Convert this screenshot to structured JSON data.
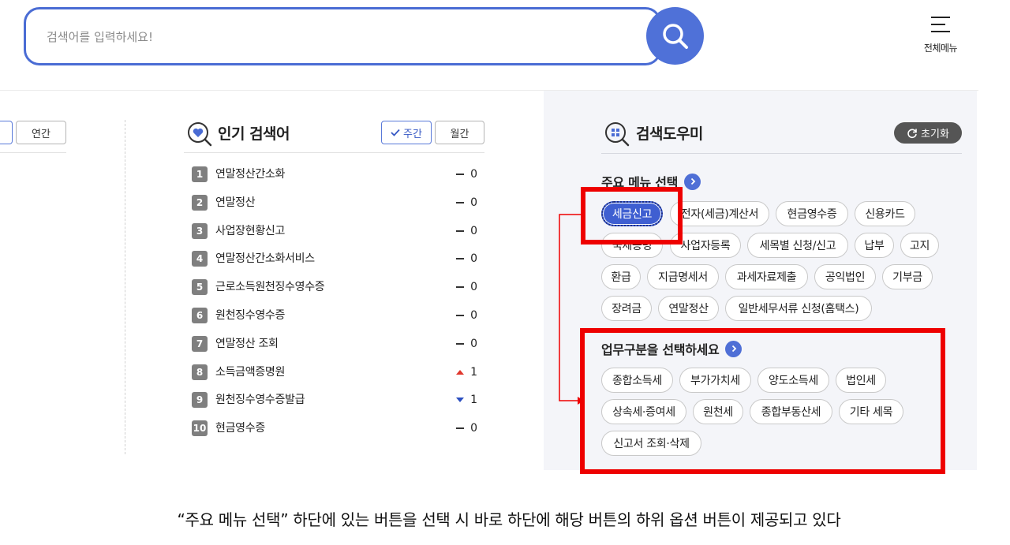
{
  "search": {
    "placeholder": "검색어를 입력하세요!"
  },
  "header": {
    "menu_label": "전체메뉴"
  },
  "left_panel": {
    "toggle_yearly": "연간"
  },
  "popular": {
    "title": "인기 검색어",
    "toggle_weekly": "주간",
    "toggle_monthly": "월간",
    "items": [
      {
        "rank": "1",
        "term": "연말정산간소화",
        "trend": "same",
        "change": "0"
      },
      {
        "rank": "2",
        "term": "연말정산",
        "trend": "same",
        "change": "0"
      },
      {
        "rank": "3",
        "term": "사업장현황신고",
        "trend": "same",
        "change": "0"
      },
      {
        "rank": "4",
        "term": "연말정산간소화서비스",
        "trend": "same",
        "change": "0"
      },
      {
        "rank": "5",
        "term": "근로소득원천징수영수증",
        "trend": "same",
        "change": "0"
      },
      {
        "rank": "6",
        "term": "원천징수영수증",
        "trend": "same",
        "change": "0"
      },
      {
        "rank": "7",
        "term": "연말정산 조회",
        "trend": "same",
        "change": "0"
      },
      {
        "rank": "8",
        "term": "소득금액증명원",
        "trend": "up",
        "change": "1"
      },
      {
        "rank": "9",
        "term": "원천징수영수증발급",
        "trend": "down",
        "change": "1"
      },
      {
        "rank": "10",
        "term": "현금영수증",
        "trend": "same",
        "change": "0"
      }
    ]
  },
  "helper": {
    "title": "검색도우미",
    "reset_label": "초기화",
    "main_menu_title": "주요 메뉴 선택",
    "main_menu": [
      "세금신고",
      "전자(세금)계산서",
      "현금영수증",
      "신용카드",
      "국제증명",
      "사업자등록",
      "세목별 신청/신고",
      "납부",
      "고지",
      "환급",
      "지급명세서",
      "과세자료제출",
      "공익법인",
      "기부금",
      "장려금",
      "연말정산",
      "일반세무서류 신청(홈택스)"
    ],
    "sub_title": "업무구분을 선택하세요",
    "sub_menu": [
      "종합소득세",
      "부가가치세",
      "양도소득세",
      "법인세",
      "상속세·증여세",
      "원천세",
      "종합부동산세",
      "기타 세목",
      "신고서 조회·삭제"
    ]
  },
  "caption": "“주요 메뉴 선택” 하단에 있는 버튼을 선택 시 바로 하단에 해당 버튼의 하위 옵션 버튼이 제공되고 있다"
}
